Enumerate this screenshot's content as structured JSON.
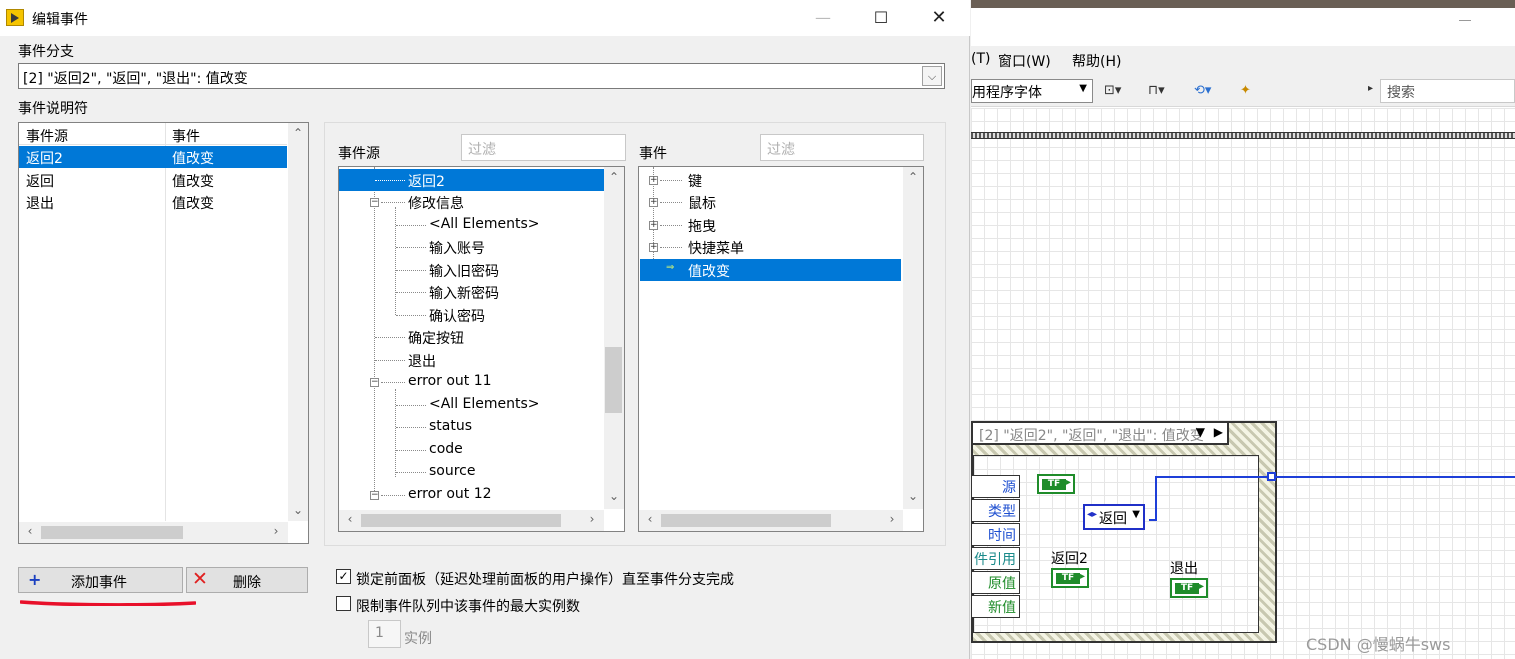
{
  "dialog": {
    "title": "编辑事件",
    "controls": {
      "minimize": "—",
      "maximize": "☐",
      "close": "✕"
    },
    "event_branch_label": "事件分支",
    "event_branch_value": "[2] \"返回2\", \"返回\", \"退出\": 值改变",
    "event_specifiers_label": "事件说明符",
    "specifier_columns": [
      "事件源",
      "事件"
    ],
    "specifier_rows": [
      {
        "source": "返回2",
        "event": "值改变"
      },
      {
        "source": "返回",
        "event": "值改变"
      },
      {
        "source": "退出",
        "event": "值改变"
      }
    ],
    "sources_label": "事件源",
    "sources_filter_placeholder": "过滤",
    "sources_tree": [
      {
        "label": "返回2"
      },
      {
        "label": "修改信息"
      },
      {
        "label": "<All Elements>"
      },
      {
        "label": "输入账号"
      },
      {
        "label": "输入旧密码"
      },
      {
        "label": "输入新密码"
      },
      {
        "label": "确认密码"
      },
      {
        "label": "确定按钮"
      },
      {
        "label": "退出"
      },
      {
        "label": "error out 11"
      },
      {
        "label": "<All Elements>"
      },
      {
        "label": "status"
      },
      {
        "label": "code"
      },
      {
        "label": "source"
      },
      {
        "label": "error out 12"
      }
    ],
    "events_label": "事件",
    "events_filter_placeholder": "过滤",
    "events_tree": [
      {
        "label": "键"
      },
      {
        "label": "鼠标"
      },
      {
        "label": "拖曳"
      },
      {
        "label": "快捷菜单"
      },
      {
        "label": "值改变"
      }
    ],
    "add_event_button": "添加事件",
    "delete_button": "删除",
    "lock_panel_label": "锁定前面板（延迟处理前面板的用户操作）直至事件分支完成",
    "lock_panel_checked": true,
    "limit_queue_label": "限制事件队列中该事件的最大实例数",
    "limit_queue_checked": false,
    "instances_value": "1",
    "instances_label": "实例"
  },
  "background_window": {
    "menu": [
      "(T)",
      "窗口(W)",
      "帮助(H)"
    ],
    "font_combo": "用程序字体",
    "search_placeholder": "搜索",
    "case_selector": "[2] \"返回2\", \"返回\", \"退出\": 值改变",
    "event_data_nodes": [
      "源",
      "类型",
      "时间",
      "件引用",
      "原值",
      "新值"
    ],
    "ring_value": "返回",
    "terminal_labels": [
      "返回2",
      "退出"
    ],
    "tf_text": "TF"
  },
  "watermark": "CSDN @慢蜗牛sws",
  "colors": {
    "selection": "#0078d7",
    "wire": "#1e3fd8",
    "bool_terminal": "#1f8c2a",
    "annotation": "#e8102a"
  }
}
